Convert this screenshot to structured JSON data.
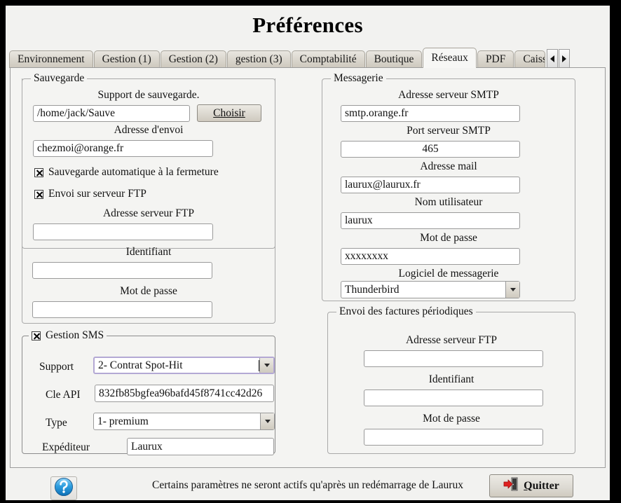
{
  "window": {
    "title": "Préférences"
  },
  "tabs": {
    "items": [
      {
        "label": "Environnement",
        "active": false
      },
      {
        "label": "Gestion (1)",
        "active": false
      },
      {
        "label": "Gestion (2)",
        "active": false
      },
      {
        "label": "gestion (3)",
        "active": false
      },
      {
        "label": "Comptabilité",
        "active": false
      },
      {
        "label": "Boutique",
        "active": false
      },
      {
        "label": "Réseaux",
        "active": true
      },
      {
        "label": "PDF",
        "active": false
      },
      {
        "label": "Caisse",
        "active": false
      }
    ],
    "scroll_left_icon": "chevron-left-icon",
    "scroll_right_icon": "chevron-right-icon"
  },
  "sauvegarde": {
    "legend": "Sauvegarde",
    "support_label": "Support de sauvegarde.",
    "support_value": "/home/jack/Sauve",
    "choisir_label": "Choisir",
    "choisir_mnemonic": "C",
    "adresse_envoi_label": "Adresse d'envoi",
    "adresse_envoi_value": "chezmoi@orange.fr",
    "auto_backup_label": "Sauvegarde automatique à la fermeture",
    "auto_backup_checked": true,
    "ftp_send_label": "Envoi sur serveur FTP",
    "ftp_send_checked": true,
    "ftp_server_label": "Adresse serveur FTP",
    "ftp_server_value": "",
    "identifiant_label": "Identifiant",
    "identifiant_value": "",
    "motdepasse_label": "Mot de passe",
    "motdepasse_value": ""
  },
  "sms": {
    "legend": "Gestion SMS",
    "enabled": true,
    "support_label": "Support",
    "support_value": "2- Contrat Spot-Hit",
    "cle_api_label": "Cle API",
    "cle_api_value": "832fb85bgfea96bafd45f8741cc42d26",
    "type_label": "Type",
    "type_value": "1- premium",
    "expediteur_label": "Expéditeur",
    "expediteur_value": "Laurux"
  },
  "messagerie": {
    "legend": "Messagerie",
    "smtp_label": "Adresse serveur SMTP",
    "smtp_value": "smtp.orange.fr",
    "port_label": "Port serveur SMTP",
    "port_value": "465",
    "mail_label": "Adresse mail",
    "mail_value": "laurux@laurux.fr",
    "user_label": "Nom utilisateur",
    "user_value": "laurux",
    "pass_label": "Mot de passe",
    "pass_value": "xxxxxxxx",
    "logiciel_label": "Logiciel de messagerie",
    "logiciel_value": "Thunderbird"
  },
  "factures": {
    "legend": "Envoi des factures périodiques",
    "ftp_label": "Adresse serveur FTP",
    "ftp_value": "",
    "identifiant_label": "Identifiant",
    "identifiant_value": "",
    "motdepasse_label": "Mot de passe",
    "motdepasse_value": ""
  },
  "bottom": {
    "help_icon": "help-question-icon",
    "notice": "Certains paramètres ne seront actifs qu'après un redémarrage de Laurux",
    "quit_label": "Quitter",
    "quit_mnemonic": "Q",
    "quit_icon": "exit-door-icon"
  }
}
